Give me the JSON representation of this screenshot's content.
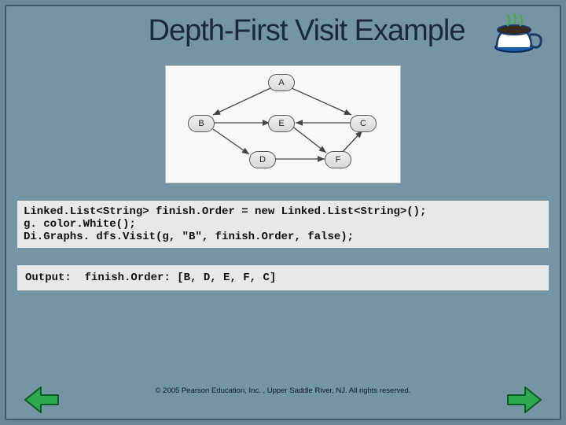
{
  "title": "Depth-First Visit Example",
  "graph": {
    "nodes": {
      "A": "A",
      "B": "B",
      "C": "C",
      "D": "D",
      "E": "E",
      "F": "F"
    }
  },
  "code": {
    "line1": "Linked.List<String> finish.Order = new Linked.List<String>();",
    "line2": "g. color.White();",
    "line3": "Di.Graphs. dfs.Visit(g, \"B\", finish.Order, false);"
  },
  "output": {
    "label": "Output:",
    "text": "finish.Order: [B, D, E, F, C]"
  },
  "copyright": "© 2005 Pearson Education, Inc. , Upper Saddle River, NJ.  All rights reserved.",
  "icons": {
    "coffee": "coffee-cup",
    "prev": "prev-arrow",
    "next": "next-arrow"
  }
}
